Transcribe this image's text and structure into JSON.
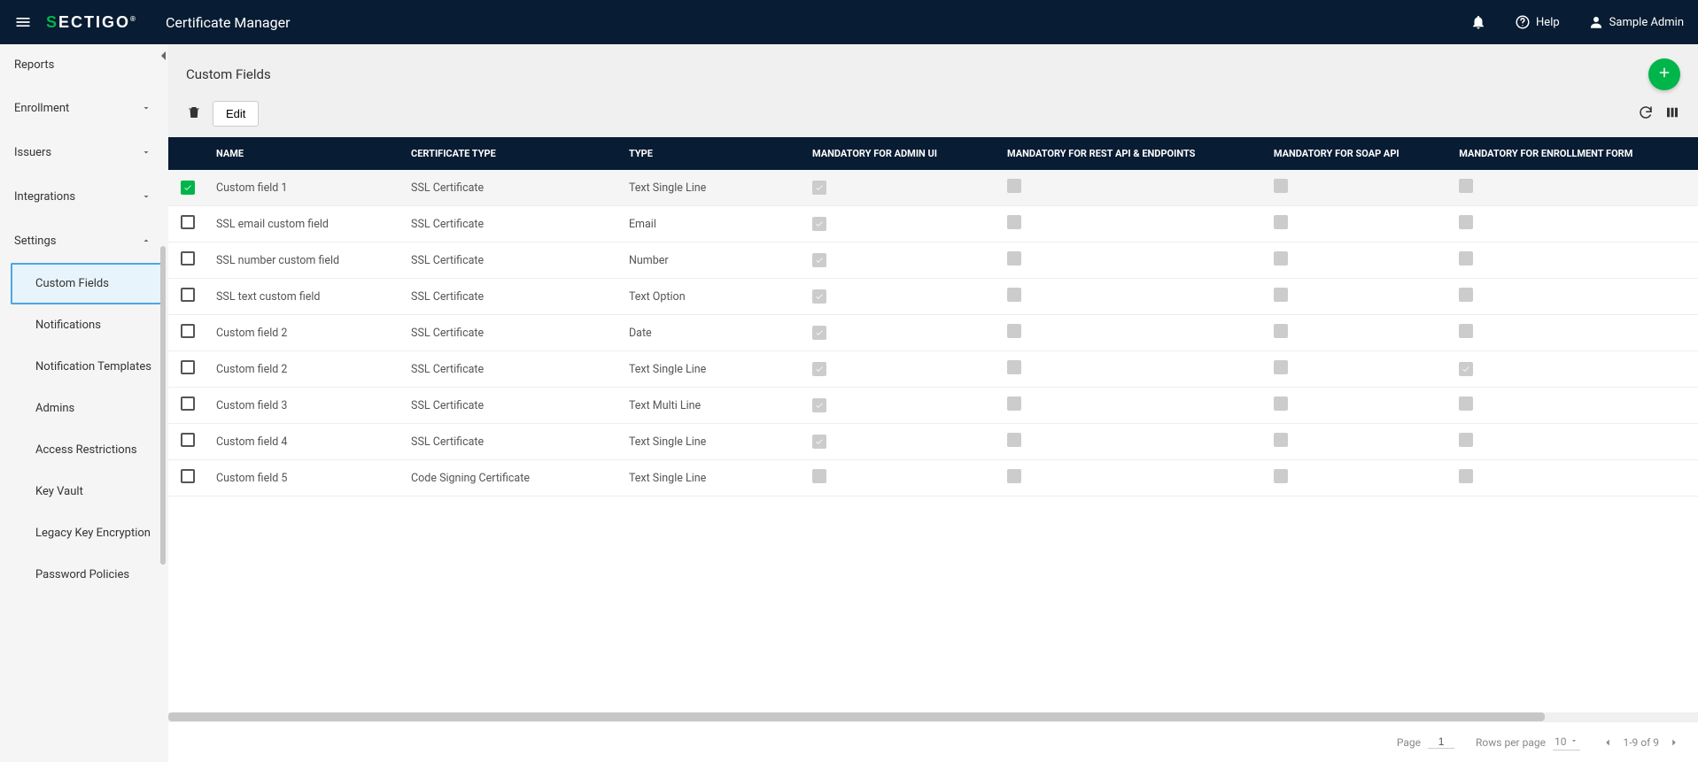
{
  "header": {
    "app_title": "Certificate Manager",
    "help_label": "Help",
    "user_name": "Sample Admin",
    "logo_text_1": "S",
    "logo_text_2": "ECTIGO"
  },
  "sidebar": {
    "items": [
      {
        "label": "Reports",
        "expandable": false
      },
      {
        "label": "Enrollment",
        "expandable": true,
        "expanded": false
      },
      {
        "label": "Issuers",
        "expandable": true,
        "expanded": false
      },
      {
        "label": "Integrations",
        "expandable": true,
        "expanded": false
      },
      {
        "label": "Settings",
        "expandable": true,
        "expanded": true
      }
    ],
    "settings_children": [
      {
        "label": "Custom Fields",
        "active": true
      },
      {
        "label": "Notifications"
      },
      {
        "label": "Notification Templates"
      },
      {
        "label": "Admins"
      },
      {
        "label": "Access Restrictions"
      },
      {
        "label": "Key Vault"
      },
      {
        "label": "Legacy Key Encryption"
      },
      {
        "label": "Password Policies"
      }
    ]
  },
  "page": {
    "title": "Custom Fields",
    "edit_label": "Edit"
  },
  "table": {
    "columns": [
      "NAME",
      "CERTIFICATE TYPE",
      "TYPE",
      "MANDATORY FOR ADMIN UI",
      "MANDATORY FOR REST API & ENDPOINTS",
      "MANDATORY FOR SOAP API",
      "MANDATORY FOR ENROLLMENT FORM"
    ],
    "rows": [
      {
        "selected": true,
        "name": "Custom field 1",
        "cert": "SSL Certificate",
        "type": "Text Single Line",
        "m_admin": true,
        "m_rest": false,
        "m_soap": false,
        "m_enroll": false
      },
      {
        "selected": false,
        "name": "SSL email custom field",
        "cert": "SSL Certificate",
        "type": "Email",
        "m_admin": true,
        "m_rest": false,
        "m_soap": false,
        "m_enroll": false
      },
      {
        "selected": false,
        "name": "SSL number custom field",
        "cert": "SSL Certificate",
        "type": "Number",
        "m_admin": true,
        "m_rest": false,
        "m_soap": false,
        "m_enroll": false
      },
      {
        "selected": false,
        "name": "SSL text custom field",
        "cert": "SSL Certificate",
        "type": "Text Option",
        "m_admin": true,
        "m_rest": false,
        "m_soap": false,
        "m_enroll": false
      },
      {
        "selected": false,
        "name": "Custom field 2",
        "cert": "SSL Certificate",
        "type": "Date",
        "m_admin": true,
        "m_rest": false,
        "m_soap": false,
        "m_enroll": false
      },
      {
        "selected": false,
        "name": "Custom field 2",
        "cert": "SSL Certificate",
        "type": "Text Single Line",
        "m_admin": true,
        "m_rest": false,
        "m_soap": false,
        "m_enroll": true
      },
      {
        "selected": false,
        "name": "Custom field 3",
        "cert": "SSL Certificate",
        "type": "Text Multi Line",
        "m_admin": true,
        "m_rest": false,
        "m_soap": false,
        "m_enroll": false
      },
      {
        "selected": false,
        "name": "Custom field 4",
        "cert": "SSL Certificate",
        "type": "Text Single Line",
        "m_admin": true,
        "m_rest": false,
        "m_soap": false,
        "m_enroll": false
      },
      {
        "selected": false,
        "name": "Custom field 5",
        "cert": "Code Signing Certificate",
        "type": "Text Single Line",
        "m_admin": false,
        "m_rest": false,
        "m_soap": false,
        "m_enroll": false
      }
    ]
  },
  "footer": {
    "page_label": "Page",
    "page_value": "1",
    "rows_per_page_label": "Rows per page",
    "rows_per_page_value": "10",
    "range_text": "1-9 of 9"
  }
}
